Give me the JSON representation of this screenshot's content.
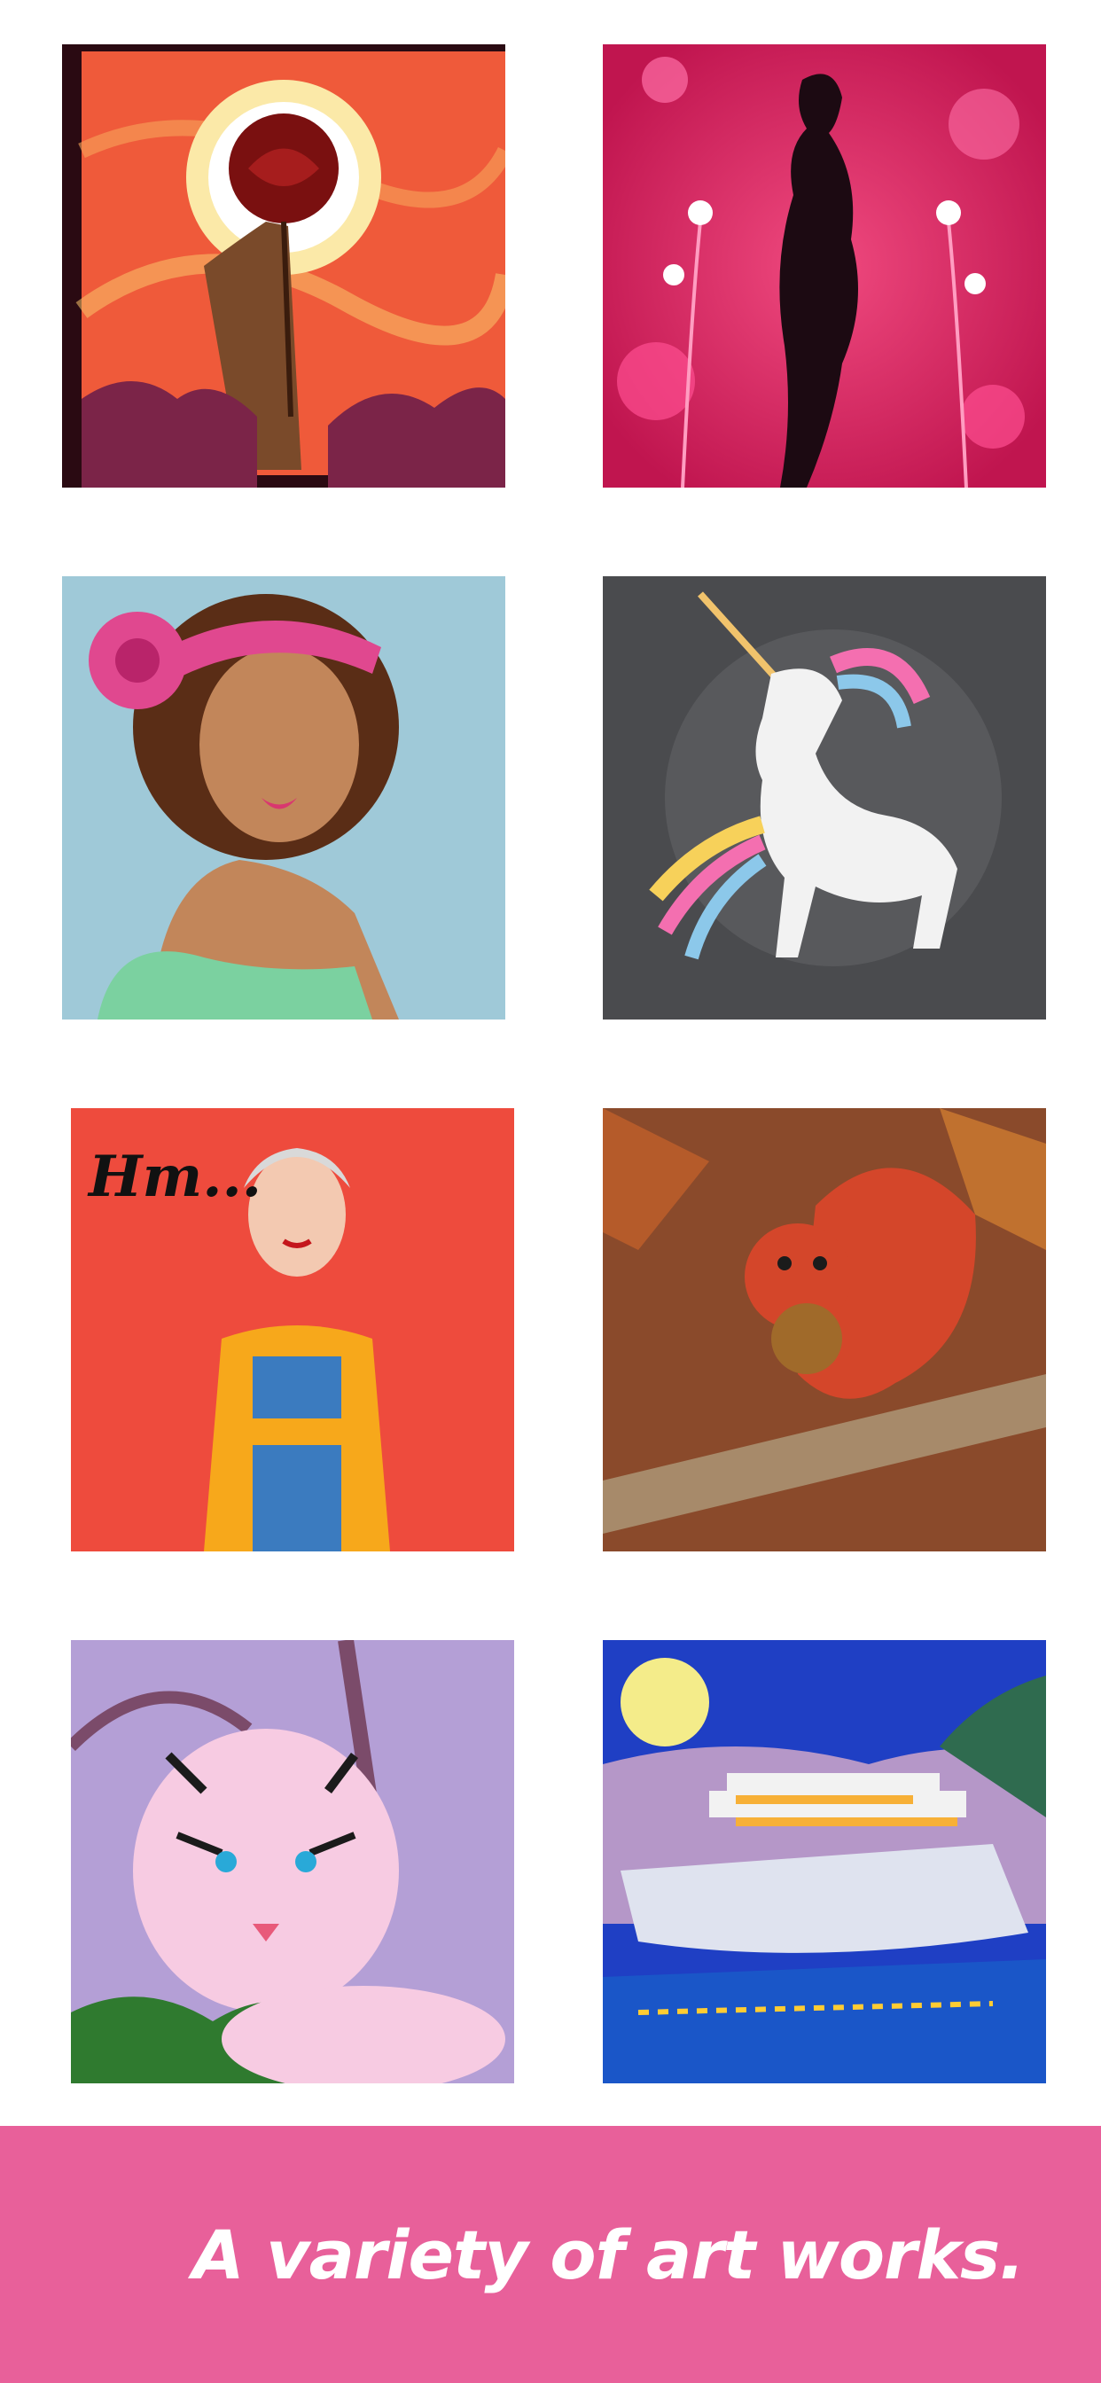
{
  "gallery": {
    "artworks": [
      {
        "subject": "hand-holding-rose",
        "bg": "#e95a3c"
      },
      {
        "subject": "pregnant-silhouette-flowers",
        "bg": "#d81b5c"
      },
      {
        "subject": "woman-pink-headband",
        "bg": "#9fc9d8"
      },
      {
        "subject": "rainbow-unicorn",
        "bg": "#4a4b4e"
      },
      {
        "subject": "woman-thinking",
        "bg": "#ee4b3d",
        "lettering": "Hm..."
      },
      {
        "subject": "squirrel-autumn",
        "bg": "#8a4a2b"
      },
      {
        "subject": "white-tiger",
        "bg": "#b49fd6"
      },
      {
        "subject": "cruise-ship-night",
        "bg": "#1f3fc4"
      }
    ]
  },
  "banner": {
    "caption": "A variety of art works.",
    "color": "#e8609a"
  }
}
